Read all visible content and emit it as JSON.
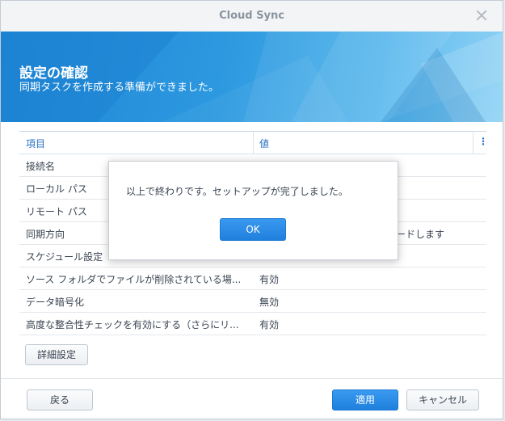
{
  "window": {
    "title": "Cloud Sync"
  },
  "banner": {
    "title": "設定の確認",
    "subtitle": "同期タスクを作成する準備ができました。"
  },
  "table": {
    "headers": {
      "item": "項目",
      "value": "値",
      "menu": "⋮"
    },
    "rows": [
      {
        "item": "接続名",
        "value": ""
      },
      {
        "item": "ローカル パス",
        "value": ""
      },
      {
        "item": "リモート パス",
        "value": ""
      },
      {
        "item": "同期方向",
        "value": "ードします"
      },
      {
        "item": "スケジュール設定",
        "value": ""
      },
      {
        "item": "ソース フォルダでファイルが削除されている場...",
        "value": "有効"
      },
      {
        "item": "データ暗号化",
        "value": "無効"
      },
      {
        "item": "高度な整合性チェックを有効にする（さらにリ...",
        "value": "有効"
      }
    ]
  },
  "buttons": {
    "advanced": "詳細設定",
    "back": "戻る",
    "apply": "適用",
    "cancel": "キャンセル"
  },
  "dialog": {
    "message": "以上で終わりです。セットアップが完了しました。",
    "ok": "OK"
  },
  "colors": {
    "accent": "#1f80dd",
    "header_text": "#2b72c2"
  }
}
